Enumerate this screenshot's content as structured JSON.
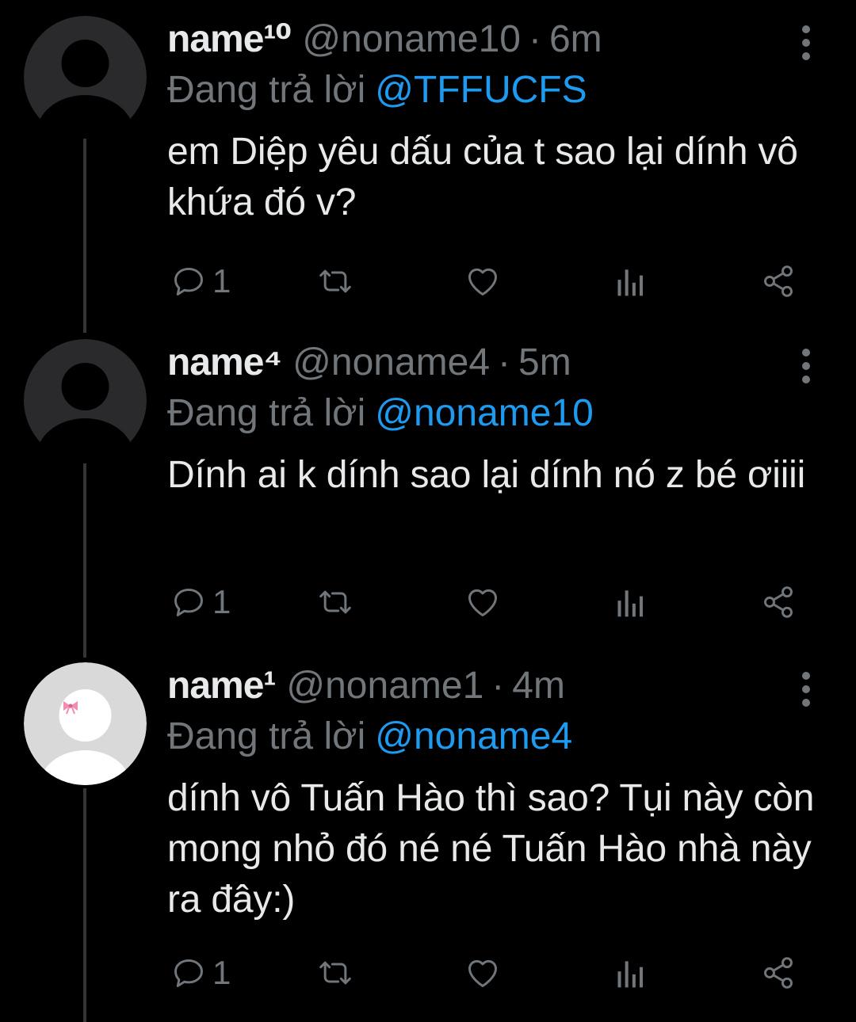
{
  "colors": {
    "background": "#000000",
    "primary_text": "#e7e9ea",
    "secondary_text": "#71767b",
    "accent": "#1d9bf0",
    "thread_line": "#333639"
  },
  "tweets": [
    {
      "display_name": "name¹⁰",
      "handle": "@noname10",
      "separator": "·",
      "time": "6m",
      "reply_prefix": "Đang trả lời",
      "reply_to": "@TFFUCFS",
      "text": "em Diệp yêu dấu của t sao lại dính vô khứa đó v?",
      "reply_count": "1",
      "avatar": "default-avatar-icon"
    },
    {
      "display_name": "name⁴",
      "handle": "@noname4",
      "separator": "·",
      "time": "5m",
      "reply_prefix": "Đang trả lời",
      "reply_to": "@noname10",
      "text": "Dính ai k dính sao lại dính nó z bé ơiiii",
      "reply_count": "1",
      "avatar": "default-avatar-icon"
    },
    {
      "display_name": "name¹",
      "handle": "@noname1",
      "separator": "·",
      "time": "4m",
      "reply_prefix": "Đang trả lời",
      "reply_to": "@noname4",
      "text": "dính vô Tuấn Hào thì sao? Tụi này còn mong nhỏ đó né né Tuấn Hào nhà này ra đây:)",
      "reply_count": "1",
      "avatar": "white-avatar-with-pink-bow-icon"
    }
  ]
}
